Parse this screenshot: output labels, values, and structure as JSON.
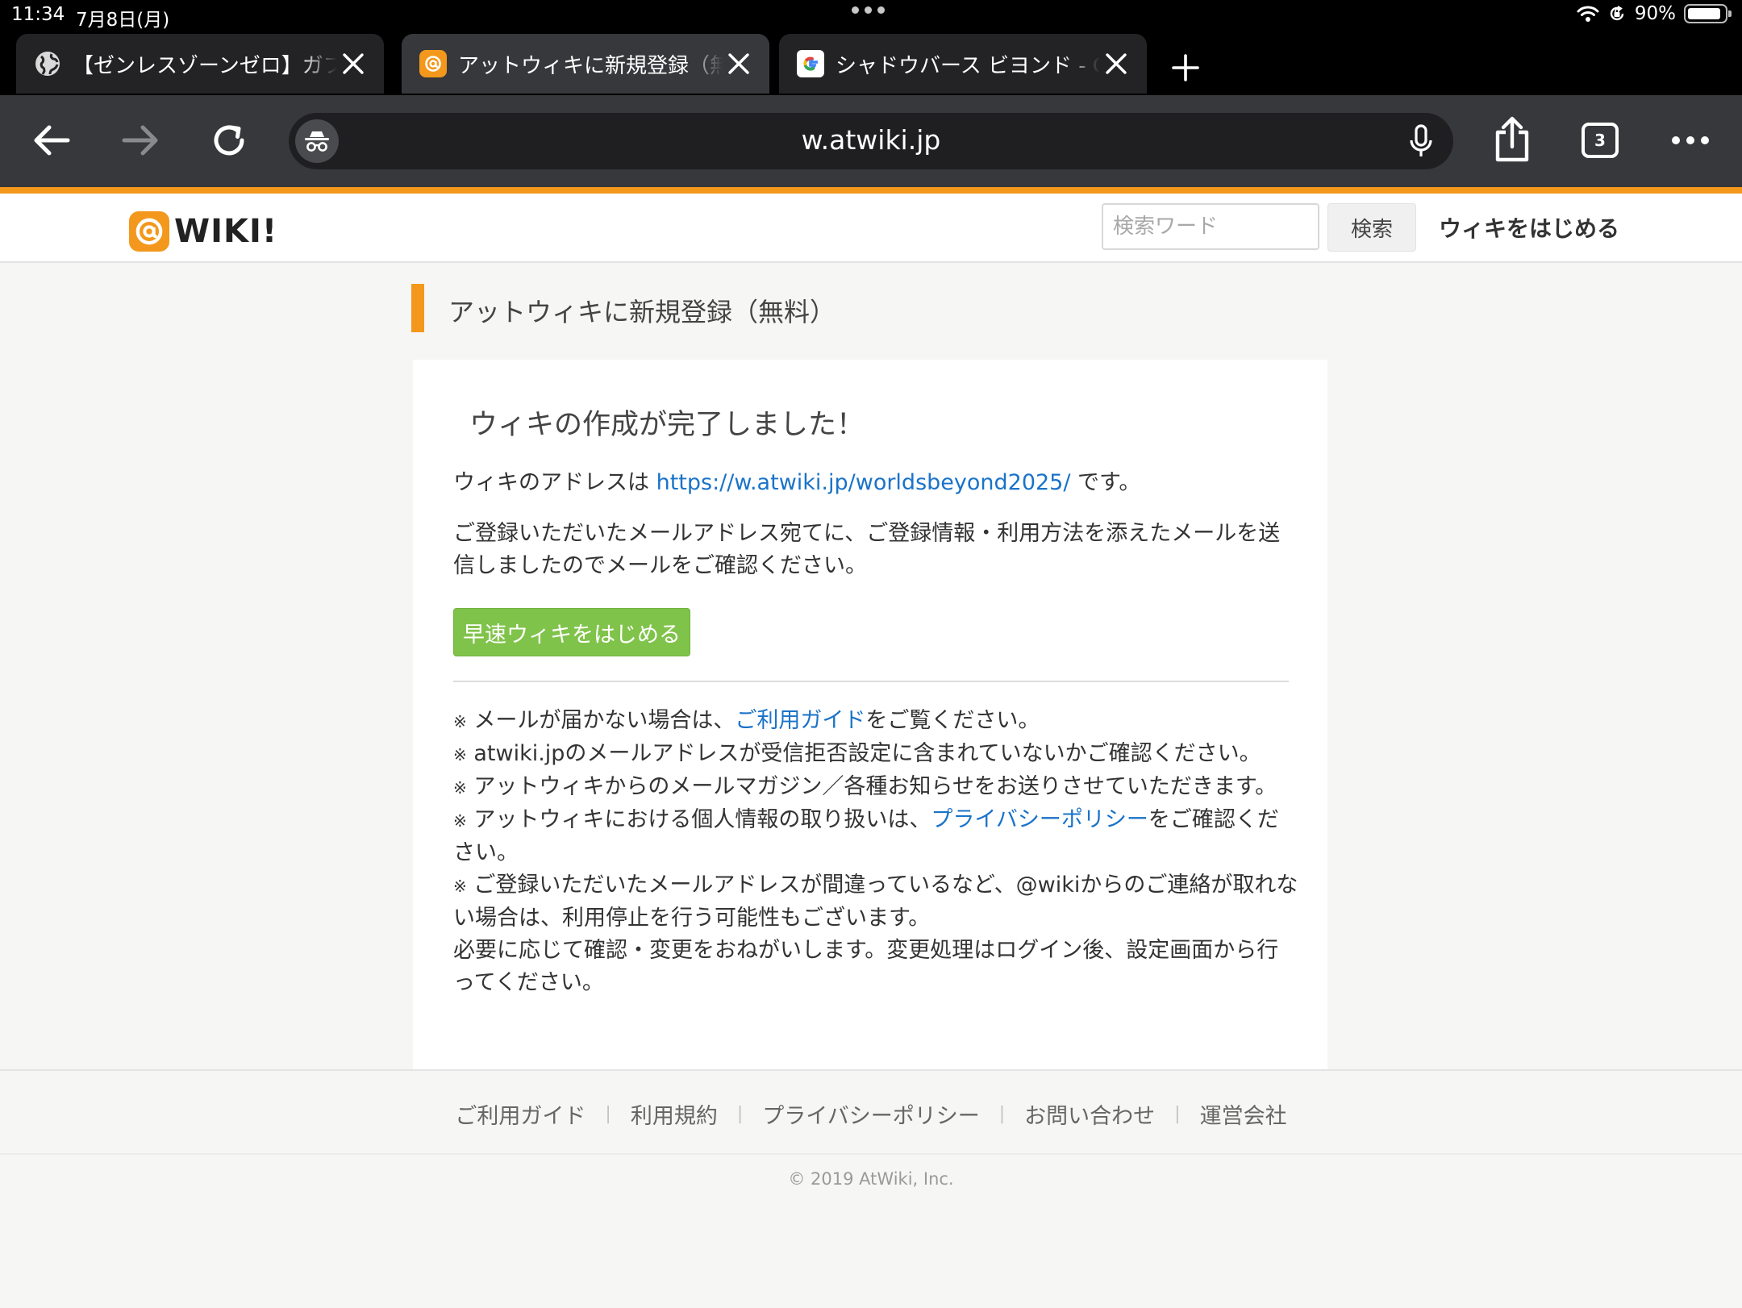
{
  "status_bar": {
    "time": "11:34",
    "date": "7月8日(月)",
    "battery": "90%"
  },
  "tabs": [
    {
      "title": "【ゼンレスゾーンゼロ】ガブリエル",
      "favicon": "globe-icon"
    },
    {
      "title": "アットウィキに新規登録（無料）",
      "favicon": "atwiki-icon",
      "active": true
    },
    {
      "title": "シャドウバース ビヨンド - Google 検索",
      "favicon": "google-icon"
    }
  ],
  "toolbar": {
    "url": "w.atwiki.jp",
    "tab_count": "3"
  },
  "site_header": {
    "logo_text": "WIKI!",
    "search_placeholder": "検索ワード",
    "search_button": "検索",
    "start_wiki": "ウィキをはじめる"
  },
  "main": {
    "heading": "アットウィキに新規登録（無料）",
    "success_title": "ウィキの作成が完了しました！",
    "address_prefix": "ウィキのアドレスは",
    "address_url": "https://w.atwiki.jp/worldsbeyond2025/",
    "address_suffix": "です。",
    "mail_sent_text": "ご登録いただいたメールアドレス宛てに、ご登録情報・利用方法を添えたメールを送信しましたのでメールをご確認ください。",
    "start_button": "早速ウィキをはじめる",
    "note_mark": "※",
    "notes": {
      "n1_before": "メールが届かない場合は、",
      "n1_link": "ご利用ガイド",
      "n1_after": "をご覧ください。",
      "n2": "atwiki.jpのメールアドレスが受信拒否設定に含まれていないかご確認ください。",
      "n3": "アットウィキからのメールマガジン／各種お知らせをお送りさせていただきます。",
      "n4_before": "アットウィキにおける個人情報の取り扱いは、",
      "n4_link": "プライバシーポリシー",
      "n4_after": "をご確認ください。",
      "n5": "ご登録いただいたメールアドレスが間違っているなど、@wikiからのご連絡が取れない場合は、利用停止を行う可能性もございます。",
      "n6": "必要に応じて確認・変更をおねがいします。変更処理はログイン後、設定画面から行ってください。"
    }
  },
  "footer": {
    "links": [
      "ご利用ガイド",
      "利用規約",
      "プライバシーポリシー",
      "お問い合わせ",
      "運営会社"
    ],
    "copyright": "© 2019 AtWiki, Inc."
  },
  "colors": {
    "accent": "#f3981c",
    "link": "#1a73c8",
    "button_green": "#80c34a"
  }
}
